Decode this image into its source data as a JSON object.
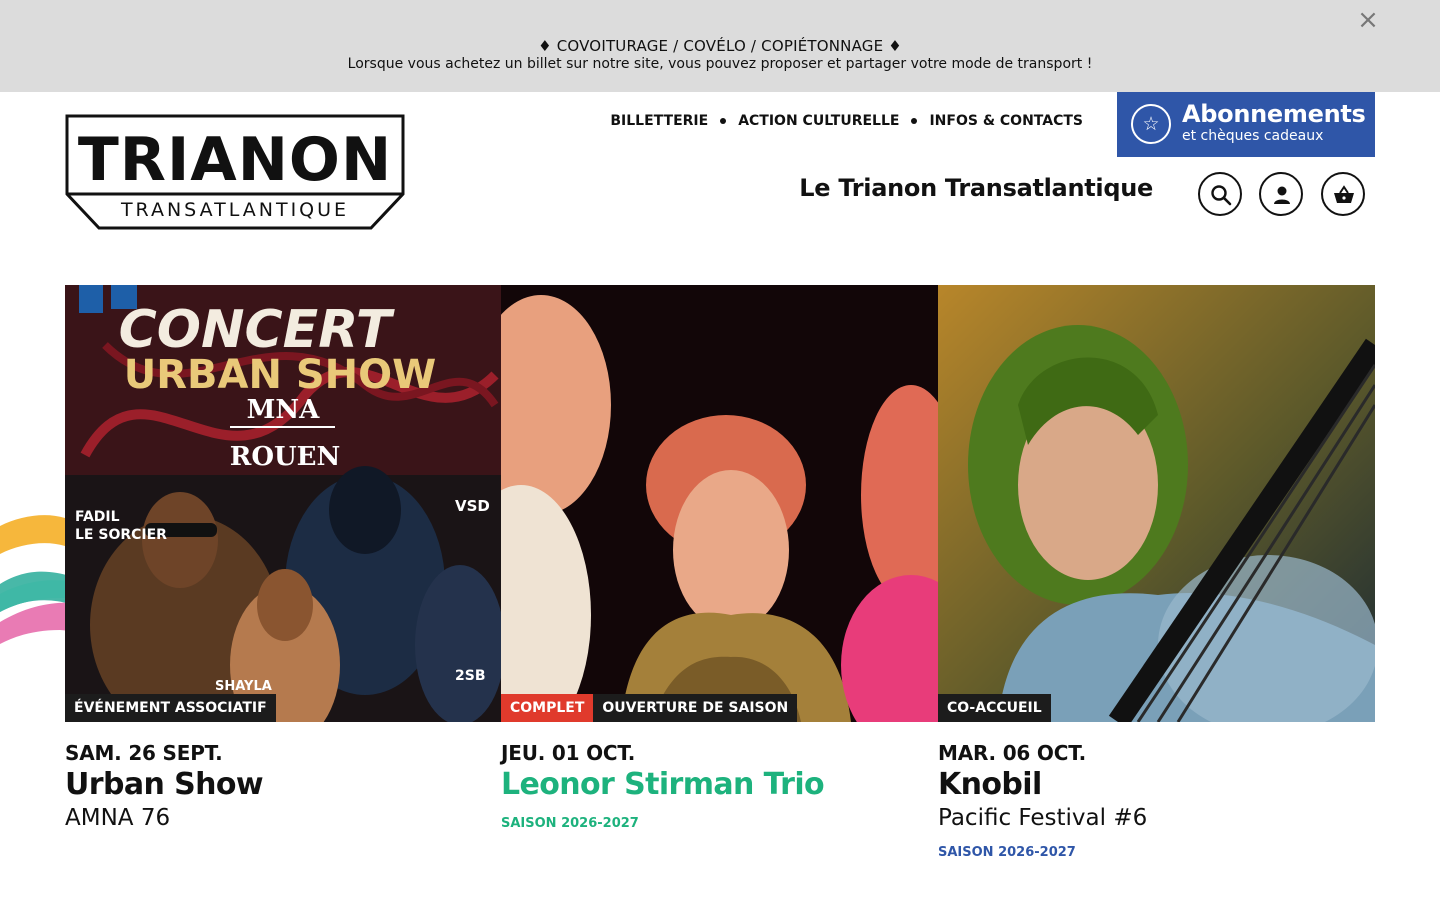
{
  "banner": {
    "title": "♦ COVOITURAGE / COVÉLO / COPIÉTONNAGE ♦",
    "text": "Lorsque vous achetez un billet sur notre site, vous pouvez proposer et partager votre mode de transport !",
    "close_label": "×"
  },
  "logo": {
    "word": "TRIANON",
    "subword": "TRANSATLANTIQUE"
  },
  "nav": {
    "items": [
      {
        "label": "BILLETTERIE"
      },
      {
        "label": "ACTION CULTURELLE"
      },
      {
        "label": "INFOS & CONTACTS"
      }
    ]
  },
  "subscription": {
    "title": "Abonnements",
    "subtitle": "et chèques cadeaux",
    "icon": "star-icon",
    "color": "#2f56a8"
  },
  "venue_name": "Le Trianon Transatlantique",
  "icons": {
    "search": "search-icon",
    "account": "user-icon",
    "cart": "basket-icon"
  },
  "events": [
    {
      "tags": [
        {
          "label": "ÉVÉNEMENT ASSOCIATIF"
        }
      ],
      "date": "SAM. 26 SEPT.",
      "title": "Urban Show",
      "subtitle": "AMNA 76",
      "season": "",
      "poster": {
        "line1": "CONCERT",
        "line2": "URBAN SHOW",
        "line3": "MNA",
        "line4": "ROUEN",
        "artist1": "FADIL",
        "artist1b": "LE SORCIER",
        "artist2": "VSD",
        "artist3": "SHAYLA",
        "artist4": "2SB"
      }
    },
    {
      "tags": [
        {
          "label": "COMPLET",
          "color": "#e03a2c"
        },
        {
          "label": "OUVERTURE DE SAISON"
        }
      ],
      "date": "JEU. 01 OCT.",
      "title": "Leonor Stirman Trio",
      "subtitle": "",
      "season": "SAISON 2026-2027",
      "title_color": "#1db27d"
    },
    {
      "tags": [
        {
          "label": "CO-ACCUEIL"
        }
      ],
      "date": "MAR. 06 OCT.",
      "title": "Knobil",
      "subtitle": "Pacific Festival #6",
      "season": "SAISON 2026-2027",
      "season_color": "#2f56a8"
    }
  ]
}
